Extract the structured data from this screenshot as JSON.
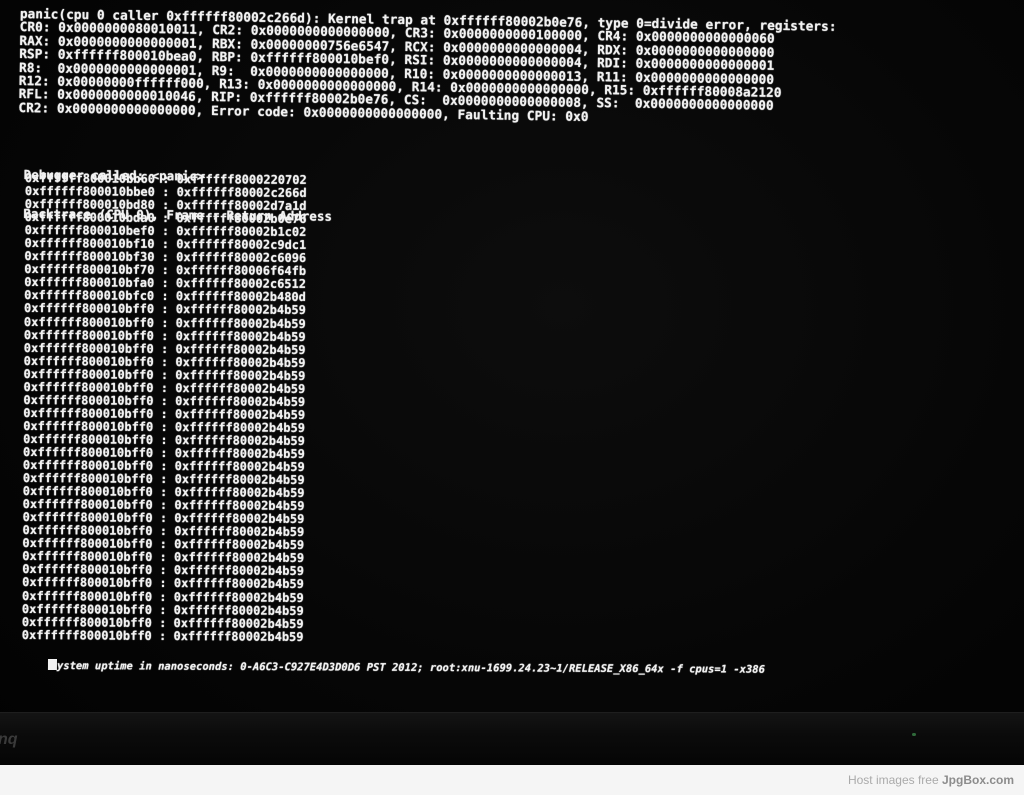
{
  "panic_screen": {
    "register_lines": [
      "panic(cpu 0 caller 0xffffff80002c266d): Kernel trap at 0xffffff80002b0e76, type 0=divide error, registers:",
      "CR0: 0x0000000080010011, CR2: 0x0000000000000000, CR3: 0x0000000000100000, CR4: 0x0000000000000060",
      "RAX: 0x0000000000000001, RBX: 0x00000000756e6547, RCX: 0x0000000000000004, RDX: 0x0000000000000000",
      "RSP: 0xffffff800010bea0, RBP: 0xffffff800010bef0, RSI: 0x0000000000000004, RDI: 0x0000000000000001",
      "R8:  0x0000000000000001, R9:  0x0000000000000000, R10: 0x0000000000000013, R11: 0x0000000000000000",
      "R12: 0x00000000ffffff000, R13: 0x0000000000000000, R14: 0x0000000000000000, R15: 0xffffff80008a2120",
      "RFL: 0x0000000000010046, RIP: 0xffffff80002b0e76, CS:  0x0000000000000008, SS:  0x0000000000000000",
      "CR2: 0x0000000000000000, Error code: 0x0000000000000000, Faulting CPU: 0x0"
    ],
    "debugger_called": "Debugger called: <panic>",
    "backtrace_header": "Backtrace (CPU 0), Frame : Return Address",
    "backtrace": [
      {
        "frame": "0xffffff800010bb60",
        "address": "0xffffff8000220702"
      },
      {
        "frame": "0xffffff800010bbe0",
        "address": "0xffffff80002c266d"
      },
      {
        "frame": "0xffffff800010bd80",
        "address": "0xffffff80002d7a1d"
      },
      {
        "frame": "0xffffff800010bda0",
        "address": "0xffffff80002b0e76"
      },
      {
        "frame": "0xffffff800010bef0",
        "address": "0xffffff80002b1c02"
      },
      {
        "frame": "0xffffff800010bf10",
        "address": "0xffffff80002c9dc1"
      },
      {
        "frame": "0xffffff800010bf30",
        "address": "0xffffff80002c6096"
      },
      {
        "frame": "0xffffff800010bf70",
        "address": "0xffffff80006f64fb"
      },
      {
        "frame": "0xffffff800010bfa0",
        "address": "0xffffff80002c6512"
      },
      {
        "frame": "0xffffff800010bfc0",
        "address": "0xffffff80002b480d"
      },
      {
        "frame": "0xffffff800010bff0",
        "address": "0xffffff80002b4b59"
      },
      {
        "frame": "0xffffff800010bff0",
        "address": "0xffffff80002b4b59"
      },
      {
        "frame": "0xffffff800010bff0",
        "address": "0xffffff80002b4b59"
      },
      {
        "frame": "0xffffff800010bff0",
        "address": "0xffffff80002b4b59"
      },
      {
        "frame": "0xffffff800010bff0",
        "address": "0xffffff80002b4b59"
      },
      {
        "frame": "0xffffff800010bff0",
        "address": "0xffffff80002b4b59"
      },
      {
        "frame": "0xffffff800010bff0",
        "address": "0xffffff80002b4b59"
      },
      {
        "frame": "0xffffff800010bff0",
        "address": "0xffffff80002b4b59"
      },
      {
        "frame": "0xffffff800010bff0",
        "address": "0xffffff80002b4b59"
      },
      {
        "frame": "0xffffff800010bff0",
        "address": "0xffffff80002b4b59"
      },
      {
        "frame": "0xffffff800010bff0",
        "address": "0xffffff80002b4b59"
      },
      {
        "frame": "0xffffff800010bff0",
        "address": "0xffffff80002b4b59"
      },
      {
        "frame": "0xffffff800010bff0",
        "address": "0xffffff80002b4b59"
      },
      {
        "frame": "0xffffff800010bff0",
        "address": "0xffffff80002b4b59"
      },
      {
        "frame": "0xffffff800010bff0",
        "address": "0xffffff80002b4b59"
      },
      {
        "frame": "0xffffff800010bff0",
        "address": "0xffffff80002b4b59"
      },
      {
        "frame": "0xffffff800010bff0",
        "address": "0xffffff80002b4b59"
      },
      {
        "frame": "0xffffff800010bff0",
        "address": "0xffffff80002b4b59"
      },
      {
        "frame": "0xffffff800010bff0",
        "address": "0xffffff80002b4b59"
      },
      {
        "frame": "0xffffff800010bff0",
        "address": "0xffffff80002b4b59"
      },
      {
        "frame": "0xffffff800010bff0",
        "address": "0xffffff80002b4b59"
      },
      {
        "frame": "0xffffff800010bff0",
        "address": "0xffffff80002b4b59"
      },
      {
        "frame": "0xffffff800010bff0",
        "address": "0xffffff80002b4b59"
      },
      {
        "frame": "0xffffff800010bff0",
        "address": "0xffffff80002b4b59"
      },
      {
        "frame": "0xffffff800010bff0",
        "address": "0xffffff80002b4b59"
      },
      {
        "frame": "0xffffff800010bff0",
        "address": "0xffffff80002b4b59"
      }
    ],
    "uptime_prefix": "S",
    "uptime_rest": "ystem uptime in nanoseconds: 0-A6C3-C927E4D3D0D6 PST 2012; root:xnu-1699.24.23~1/RELEASE_X86_64x -f cpus=1 -x386"
  },
  "monitor": {
    "brand_text": "nq",
    "text_color": "#f2f2f2",
    "background_color": "#000000"
  },
  "footer": {
    "text_prefix": "Host images free ",
    "text_brand": "JpgBox.com"
  }
}
